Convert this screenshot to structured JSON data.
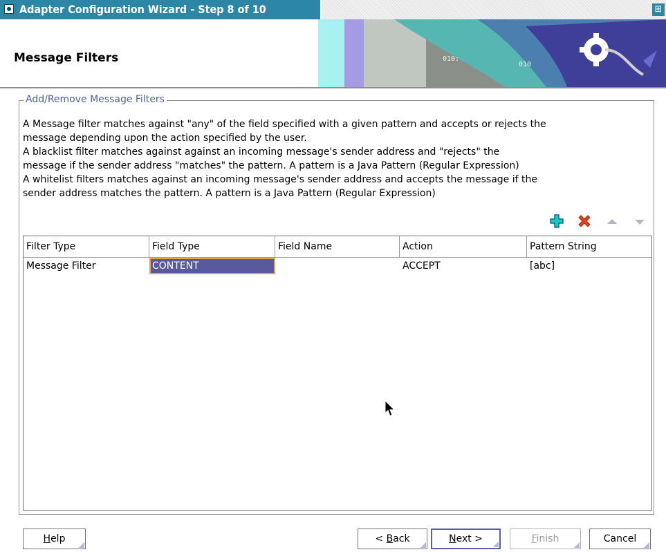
{
  "window": {
    "title": "Adapter Configuration Wizard - Step 8 of 10",
    "maximize_glyph": "⊞"
  },
  "header": {
    "title": "Message Filters",
    "banner_text_1": "010:",
    "banner_text_2": "010"
  },
  "group": {
    "legend": "Add/Remove Message Filters",
    "description_lines": [
      "A Message filter matches against \"any\" of the field specified with a given pattern and accepts or rejects the",
      "message depending upon the action specified by the user.",
      "A blacklist filter matches against against an incoming message's sender address and \"rejects\" the",
      "message if the sender address \"matches\" the pattern. A pattern is a Java Pattern (Regular Expression)",
      "A whitelist filters matches against an incoming message's sender address and accepts the message if the",
      "sender address matches the pattern. A pattern is a Java Pattern (Regular Expression)"
    ]
  },
  "toolbar": {
    "add_icon": "plus-icon",
    "remove_icon": "x-icon",
    "move_up_icon": "triangle-up-icon",
    "move_down_icon": "triangle-down-icon"
  },
  "table": {
    "columns": [
      "Filter Type",
      "Field Type",
      "Field Name",
      "Action",
      "Pattern String"
    ],
    "rows": [
      [
        "Message Filter",
        "CONTENT",
        "",
        "ACCEPT",
        "[abc]"
      ]
    ]
  },
  "buttons": {
    "help_mnemonic": "H",
    "help_rest": "elp",
    "back_prefix": "< ",
    "back_mnemonic": "B",
    "back_rest": "ack",
    "next_mnemonic": "N",
    "next_rest": "ext >",
    "finish_mnemonic": "F",
    "finish_rest": "inish",
    "cancel_label": "Cancel"
  },
  "colors": {
    "title_bar": "#2c86a6",
    "selection": "#595a9d",
    "selection_border": "#e2a54a",
    "legend_text": "#4a5fb0",
    "add_icon": "#19c9c3",
    "remove_icon": "#e8401a"
  }
}
